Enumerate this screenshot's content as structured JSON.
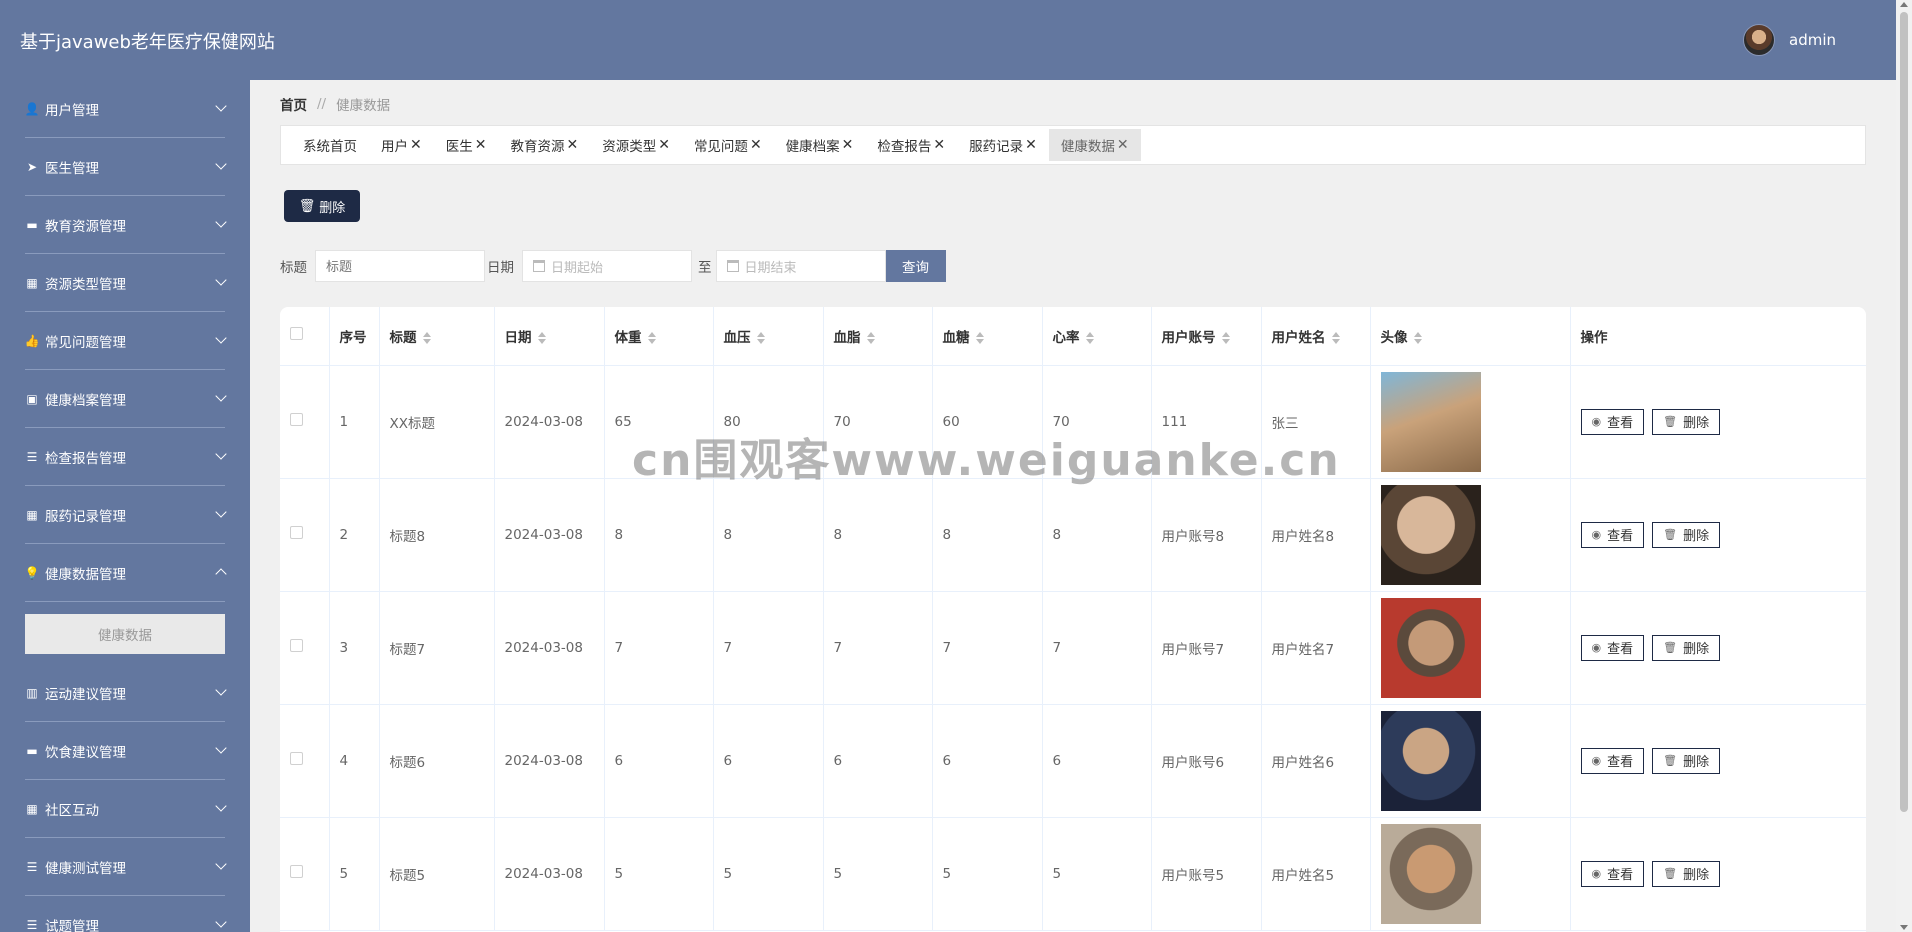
{
  "app": {
    "title": "基于javaweb老年医疗保健网站",
    "username": "admin"
  },
  "sidebar": {
    "items": [
      {
        "label": "用户管理",
        "icon": "user-icon",
        "glyph": "👤"
      },
      {
        "label": "医生管理",
        "icon": "paper-plane-icon",
        "glyph": "➤"
      },
      {
        "label": "教育资源管理",
        "icon": "monitor-icon",
        "glyph": "▬"
      },
      {
        "label": "资源类型管理",
        "icon": "grid-icon",
        "glyph": "▦"
      },
      {
        "label": "常见问题管理",
        "icon": "thumbs-up-icon",
        "glyph": "👍"
      },
      {
        "label": "健康档案管理",
        "icon": "file-x-icon",
        "glyph": "▣"
      },
      {
        "label": "检查报告管理",
        "icon": "list-icon",
        "glyph": "☰"
      },
      {
        "label": "服药记录管理",
        "icon": "grid-icon",
        "glyph": "▦"
      },
      {
        "label": "健康数据管理",
        "icon": "lightbulb-icon",
        "glyph": "💡",
        "expanded": true,
        "sub": "健康数据"
      },
      {
        "label": "运动建议管理",
        "icon": "books-icon",
        "glyph": "▥"
      },
      {
        "label": "饮食建议管理",
        "icon": "ticket-icon",
        "glyph": "▬"
      },
      {
        "label": "社区互动",
        "icon": "grid-icon",
        "glyph": "▦"
      },
      {
        "label": "健康测试管理",
        "icon": "menu-icon",
        "glyph": "☰"
      },
      {
        "label": "试题管理",
        "icon": "list-icon",
        "glyph": "☰"
      }
    ]
  },
  "breadcrumb": {
    "home": "首页",
    "sep": "//",
    "current": "健康数据"
  },
  "tabs": [
    {
      "label": "系统首页",
      "closable": false
    },
    {
      "label": "用户",
      "closable": true
    },
    {
      "label": "医生",
      "closable": true
    },
    {
      "label": "教育资源",
      "closable": true
    },
    {
      "label": "资源类型",
      "closable": true
    },
    {
      "label": "常见问题",
      "closable": true
    },
    {
      "label": "健康档案",
      "closable": true
    },
    {
      "label": "检查报告",
      "closable": true
    },
    {
      "label": "服药记录",
      "closable": true
    },
    {
      "label": "健康数据",
      "closable": true,
      "active": true
    }
  ],
  "toolbar": {
    "delete_label": "删除"
  },
  "search": {
    "title_label": "标题",
    "title_placeholder": "标题",
    "date_label": "日期",
    "date_start_placeholder": "日期起始",
    "to_label": "至",
    "date_end_placeholder": "日期结束",
    "query_label": "查询"
  },
  "table": {
    "headers": [
      "序号",
      "标题",
      "日期",
      "体重",
      "血压",
      "血脂",
      "血糖",
      "心率",
      "用户账号",
      "用户姓名",
      "头像",
      "操作"
    ],
    "view_label": "查看",
    "delete_label": "删除",
    "rows": [
      {
        "no": "1",
        "title": "XX标题",
        "date": "2024-03-08",
        "weight": "65",
        "bp": "80",
        "lipid": "70",
        "sugar": "60",
        "hr": "70",
        "account": "111",
        "name": "张三",
        "avatar": "young-man-photo"
      },
      {
        "no": "2",
        "title": "标题8",
        "date": "2024-03-08",
        "weight": "8",
        "bp": "8",
        "lipid": "8",
        "sugar": "8",
        "hr": "8",
        "account": "用户账号8",
        "name": "用户姓名8",
        "avatar": "elderly-man-photo"
      },
      {
        "no": "3",
        "title": "标题7",
        "date": "2024-03-08",
        "weight": "7",
        "bp": "7",
        "lipid": "7",
        "sugar": "7",
        "hr": "7",
        "account": "用户账号7",
        "name": "用户姓名7",
        "avatar": "elderly-man-cap-photo"
      },
      {
        "no": "4",
        "title": "标题6",
        "date": "2024-03-08",
        "weight": "6",
        "bp": "6",
        "lipid": "6",
        "sugar": "6",
        "hr": "6",
        "account": "用户账号6",
        "name": "用户姓名6",
        "avatar": "elderly-man-saluting-photo"
      },
      {
        "no": "5",
        "title": "标题5",
        "date": "2024-03-08",
        "weight": "5",
        "bp": "5",
        "lipid": "5",
        "sugar": "5",
        "hr": "5",
        "account": "用户账号5",
        "name": "用户姓名5",
        "avatar": "elderly-woman-photo"
      }
    ]
  },
  "watermark": "cn围观客www.weiguanke.cn"
}
